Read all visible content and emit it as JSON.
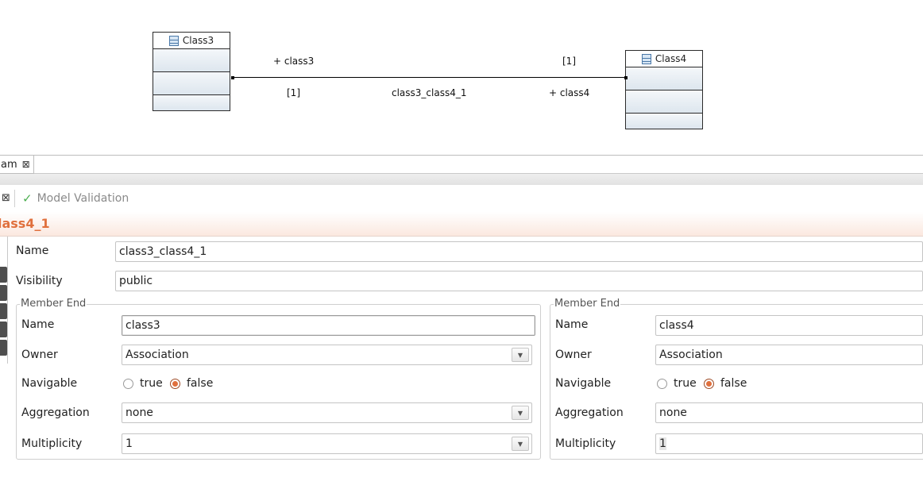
{
  "diagram": {
    "class_left": {
      "name": "Class3"
    },
    "class_right": {
      "name": "Class4"
    },
    "association": {
      "name": "class3_class4_1",
      "end_left_role": "+ class3",
      "end_left_mult": "[1]",
      "end_right_role": "+ class4",
      "end_right_mult": "[1]"
    }
  },
  "editor_tab": {
    "label": "am",
    "close": "⊠"
  },
  "views": {
    "close": "⊠",
    "model_validation": "Model Validation",
    "check": "✓"
  },
  "properties": {
    "title": "lass4_1",
    "name_label": "Name",
    "name_value": "class3_class4_1",
    "visibility_label": "Visibility",
    "visibility_value": "public",
    "member_end_left": {
      "group_title": "Member End",
      "name_label": "Name",
      "name_value": "class3",
      "owner_label": "Owner",
      "owner_value": "Association",
      "navigable_label": "Navigable",
      "true_label": "true",
      "false_label": "false",
      "aggregation_label": "Aggregation",
      "aggregation_value": "none",
      "multiplicity_label": "Multiplicity",
      "multiplicity_value": "1"
    },
    "member_end_right": {
      "group_title": "Member End",
      "name_label": "Name",
      "name_value": "class4",
      "owner_label": "Owner",
      "owner_value": "Association",
      "navigable_label": "Navigable",
      "true_label": "true",
      "false_label": "false",
      "aggregation_label": "Aggregation",
      "aggregation_value": "none",
      "multiplicity_label": "Multiplicity",
      "multiplicity_value": "1"
    }
  },
  "colors": {
    "accent": "#e0703d",
    "check": "#4caf50"
  }
}
